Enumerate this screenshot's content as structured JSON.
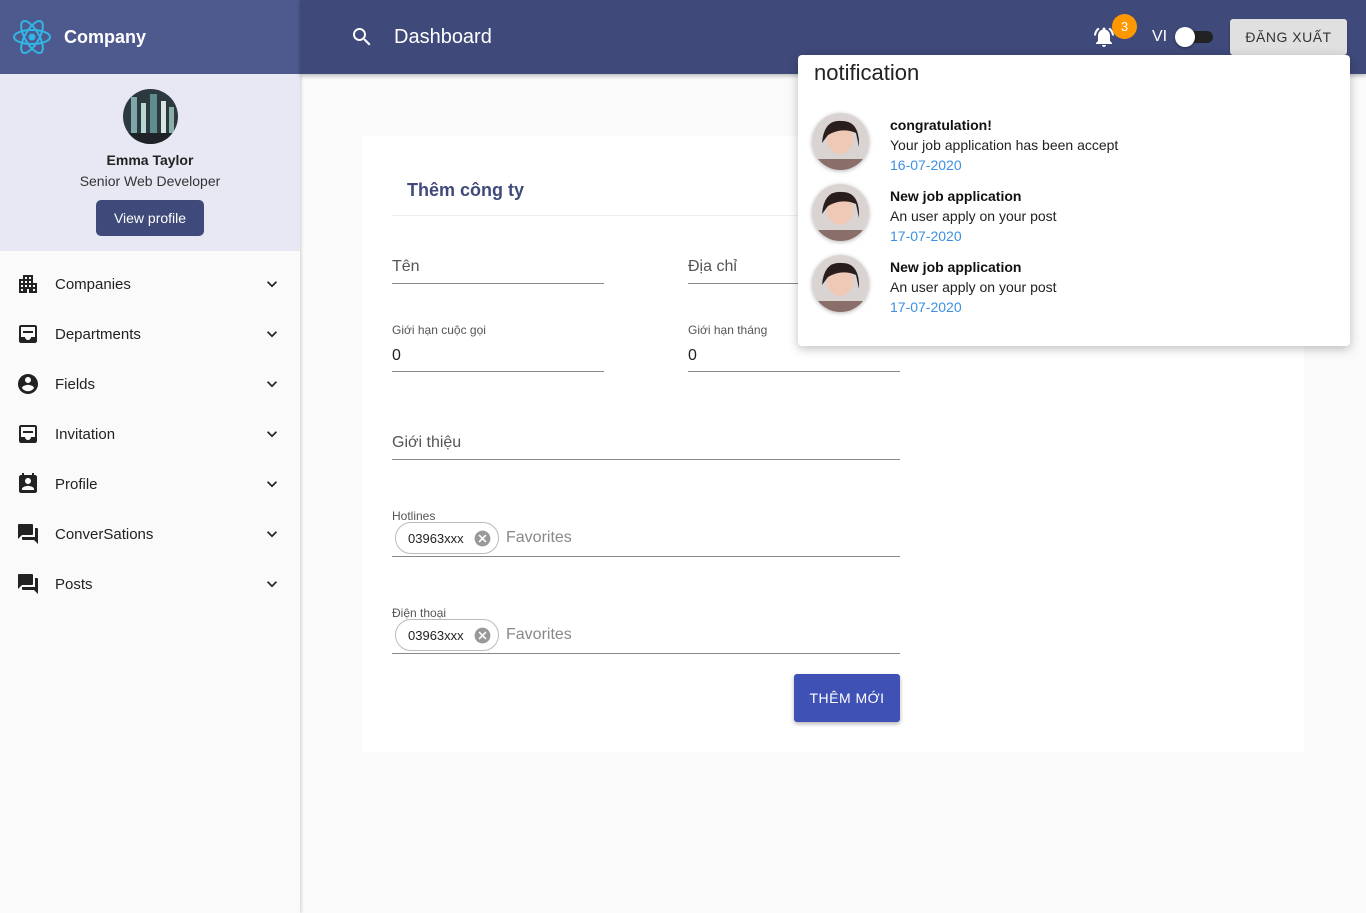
{
  "brand": {
    "name": "Company"
  },
  "user": {
    "name": "Emma Taylor",
    "role": "Senior Web Developer",
    "view_profile_label": "View profile"
  },
  "nav": {
    "items": [
      {
        "label": "Companies",
        "icon": "building-icon"
      },
      {
        "label": "Departments",
        "icon": "inbox-icon"
      },
      {
        "label": "Fields",
        "icon": "account-circle-icon"
      },
      {
        "label": "Invitation",
        "icon": "inbox-icon"
      },
      {
        "label": "Profile",
        "icon": "badge-icon"
      },
      {
        "label": "ConverSations",
        "icon": "forum-icon"
      },
      {
        "label": "Posts",
        "icon": "forum-icon"
      }
    ]
  },
  "header": {
    "title": "Dashboard",
    "notification_count": "3",
    "language": "VI",
    "logout_label": "ĐĂNG XUẤT"
  },
  "form": {
    "title": "Thêm công ty",
    "name_placeholder": "Tên",
    "address_placeholder": "Địa chỉ",
    "call_limit_label": "Giới hạn cuộc gọi",
    "call_limit_value": "0",
    "month_limit_label": "Giới hạn tháng",
    "month_limit_value": "0",
    "intro_placeholder": "Giới thiệu",
    "hotlines_label": "Hotlines",
    "hotlines_chip": "03963xxx",
    "hotlines_placeholder": "Favorites",
    "phone_label": "Điện thoại",
    "phone_chip": "03963xxx",
    "phone_placeholder": "Favorites",
    "submit_label": "THÊM MỚI"
  },
  "notifications": {
    "title": "notification",
    "items": [
      {
        "head": "congratulation!",
        "body": "Your job application has been accept",
        "date": "16-07-2020"
      },
      {
        "head": "New job application",
        "body": "An user apply on your post",
        "date": "17-07-2020"
      },
      {
        "head": "New job application",
        "body": "An user apply on your post",
        "date": "17-07-2020"
      }
    ]
  },
  "colors": {
    "primary": "#3f4a7a",
    "brand_bar": "#4e5a8e",
    "badge": "#ff9800",
    "button": "#3f51b5",
    "date": "#3d8fe0"
  }
}
